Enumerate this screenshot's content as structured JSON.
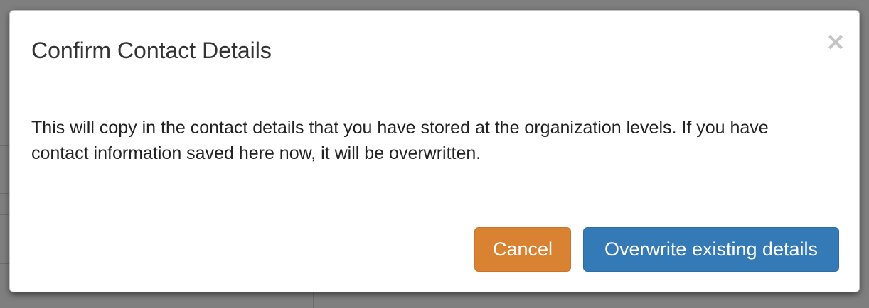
{
  "dialog": {
    "title": "Confirm Contact Details",
    "close_symbol": "×",
    "message": "This will copy in the contact details that you have stored at the organization levels. If you have contact information saved here now, it will be overwritten.",
    "cancel_label": "Cancel",
    "confirm_label": "Overwrite existing details"
  },
  "colors": {
    "overlay": "#7f7f7f",
    "cancel_button": "#d98232",
    "confirm_button": "#337ab7",
    "title_text": "#333333"
  },
  "icons": {
    "close": "close-icon"
  }
}
